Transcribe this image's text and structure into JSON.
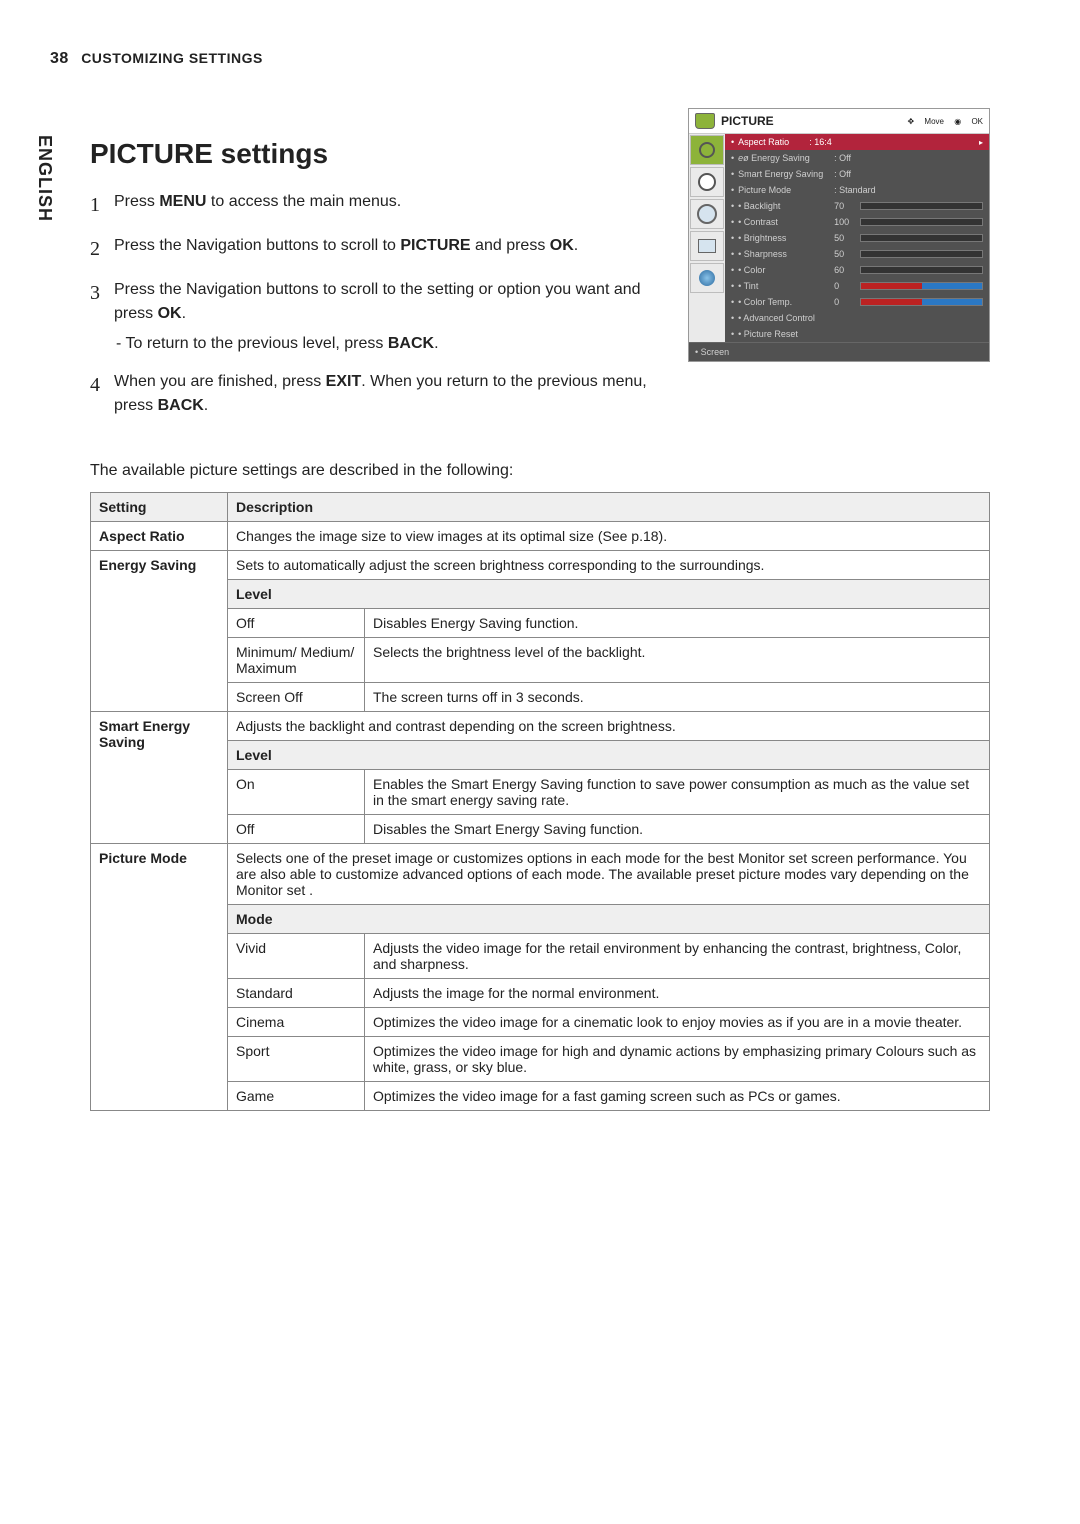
{
  "header": {
    "page_number": "38",
    "section": "CUSTOMIZING SETTINGS"
  },
  "lang_tab": "ENGLISH",
  "title": "PICTURE settings",
  "steps": [
    {
      "n": "1",
      "html": "Press <b>MENU</b> to access the main menus."
    },
    {
      "n": "2",
      "html": "Press the Navigation buttons to scroll to <b>PICTURE</b> and press <b>OK</b>."
    },
    {
      "n": "3",
      "html": "Press the Navigation buttons to scroll to the setting or option you want and press <b>OK</b>.",
      "sub": "- To return to the previous level, press <b>BACK</b>."
    },
    {
      "n": "4",
      "html": "When you are finished, press <b>EXIT</b>. When you return to the previous menu, press <b>BACK</b>."
    }
  ],
  "osd": {
    "title": "PICTURE",
    "hints": {
      "move": "Move",
      "ok": "OK"
    },
    "selected": {
      "label": "Aspect Ratio",
      "value": ": 16:4"
    },
    "rows": [
      {
        "label": "Energy Saving",
        "value": ": Off",
        "pre": "eø ",
        "type": "text"
      },
      {
        "label": "Smart Energy Saving",
        "value": ": Off",
        "type": "text"
      },
      {
        "label": "Picture Mode",
        "value": ": Standard",
        "type": "text"
      },
      {
        "label": "Backlight",
        "value": "70",
        "type": "bar",
        "pct": 70
      },
      {
        "label": "Contrast",
        "value": "100",
        "type": "bar",
        "pct": 100
      },
      {
        "label": "Brightness",
        "value": "50",
        "type": "bar",
        "pct": 50
      },
      {
        "label": "Sharpness",
        "value": "50",
        "type": "bar",
        "pct": 50
      },
      {
        "label": "Color",
        "value": "60",
        "type": "bar",
        "pct": 60
      },
      {
        "label": "Tint",
        "value": "0",
        "type": "rg"
      },
      {
        "label": "Color Temp.",
        "value": "0",
        "type": "rg"
      },
      {
        "label": "Advanced Control",
        "type": "none"
      },
      {
        "label": "Picture Reset",
        "type": "none"
      }
    ],
    "footer": "Screen"
  },
  "intro": "The available picture settings are described in the following:",
  "table_headers": {
    "setting": "Setting",
    "description": "Description",
    "level": "Level",
    "mode": "Mode"
  },
  "settings_table": [
    {
      "setting": "Aspect Ratio",
      "desc": "Changes the image size to view images at its optimal size (See p.18)."
    },
    {
      "setting": "Energy Saving",
      "desc": "Sets to automatically adjust the screen brightness corresponding to the surroundings.",
      "levels": [
        {
          "k": "Off",
          "v": "Disables Energy Saving function."
        },
        {
          "k": "Minimum/ Medium/ Maximum",
          "v": "Selects the brightness level of the backlight."
        },
        {
          "k": "Screen Off",
          "v": "The screen turns off in 3 seconds."
        }
      ]
    },
    {
      "setting": "Smart Energy Saving",
      "desc": "Adjusts the backlight and contrast depending on the screen brightness.",
      "levels": [
        {
          "k": "On",
          "v": "Enables the Smart Energy Saving function to save power consumption as much as the value set in the smart energy saving rate."
        },
        {
          "k": "Off",
          "v": "Disables the Smart Energy Saving function."
        }
      ]
    },
    {
      "setting": "Picture Mode",
      "desc": "Selects one of the preset image or customizes options in each mode for the best Monitor set screen performance. You are also able to customize advanced options of each mode. The available preset picture modes vary depending on the Monitor set .",
      "mode_header": true,
      "levels": [
        {
          "k": "Vivid",
          "v": "Adjusts the video image for the retail environment by enhancing the contrast, brightness, Color, and sharpness."
        },
        {
          "k": "Standard",
          "v": "Adjusts the image for the normal environment."
        },
        {
          "k": "Cinema",
          "v": "Optimizes the video image for a cinematic look to enjoy movies as if you are in a movie theater."
        },
        {
          "k": "Sport",
          "v": "Optimizes the video image for high and dynamic actions by emphasizing primary Colours such as white, grass, or sky blue."
        },
        {
          "k": "Game",
          "v": "Optimizes the video image for a fast gaming screen such as PCs or games."
        }
      ]
    }
  ]
}
